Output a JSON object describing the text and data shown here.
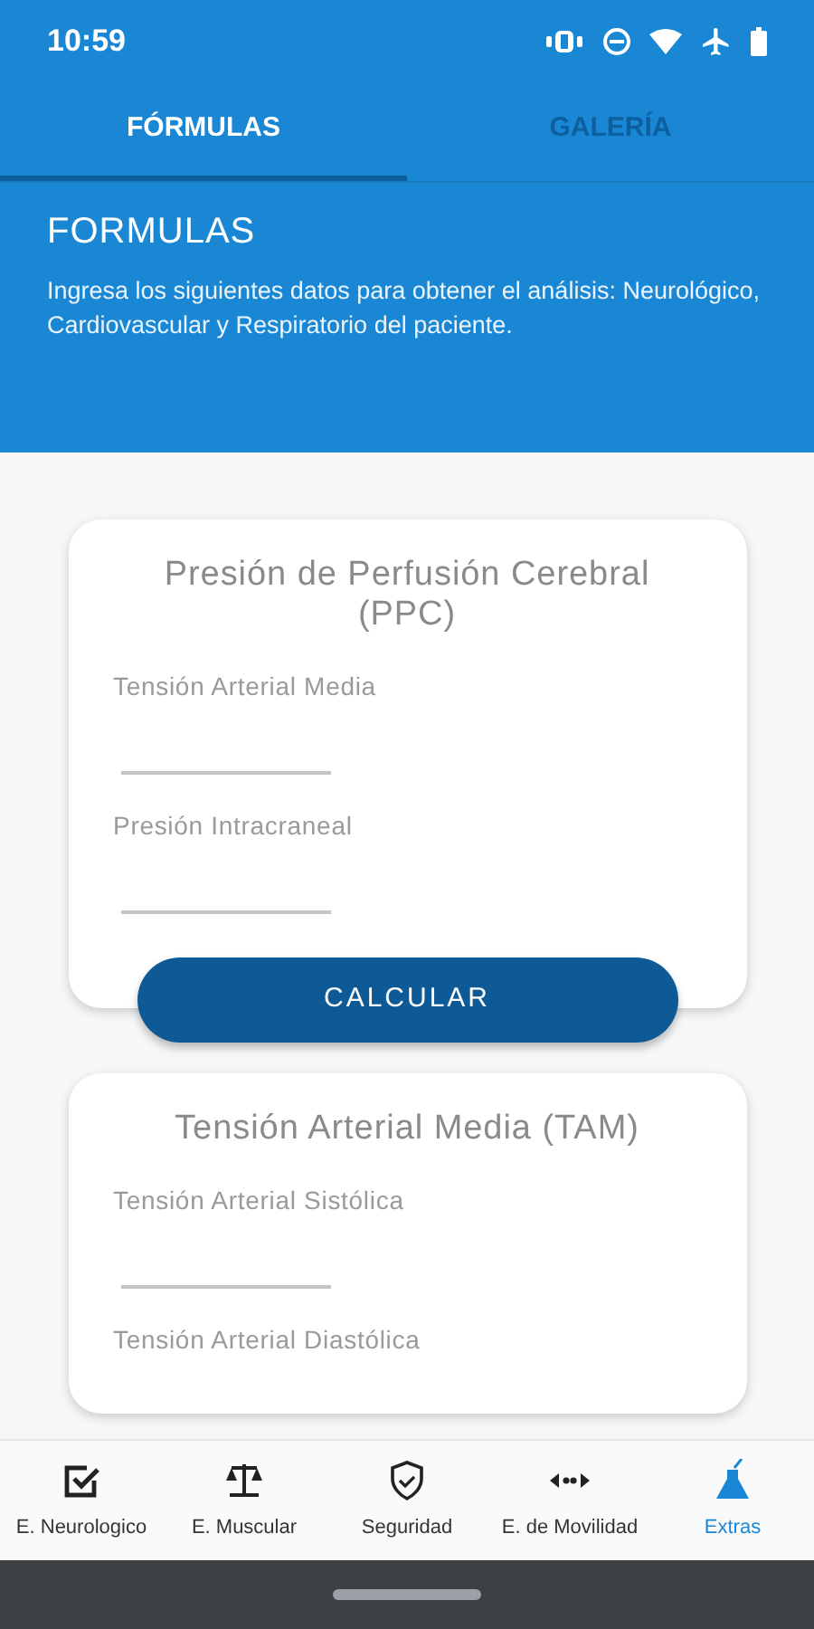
{
  "status_bar": {
    "time": "10:59"
  },
  "tabs": [
    {
      "label": "FÓRMULAS",
      "selected": true
    },
    {
      "label": "GALERÍA",
      "selected": false
    }
  ],
  "header": {
    "title": "FORMULAS",
    "description": "Ingresa los siguientes datos para obtener el análisis: Neurológico, Cardiovascular y Respiratorio del paciente."
  },
  "cards": [
    {
      "title": "Presión de Perfusión Cerebral (PPC)",
      "fields": [
        {
          "label": "Tensión Arterial Media"
        },
        {
          "label": "Presión Intracraneal"
        }
      ],
      "button": "CALCULAR"
    },
    {
      "title": "Tensión Arterial Media (TAM)",
      "fields": [
        {
          "label": "Tensión Arterial Sistólica"
        },
        {
          "label": "Tensión Arterial Diastólica"
        }
      ]
    }
  ],
  "bottom_nav": [
    {
      "label": "E. Neurologico",
      "kind": "check",
      "selected": false
    },
    {
      "label": "E. Muscular",
      "kind": "scale",
      "selected": false
    },
    {
      "label": "Seguridad",
      "kind": "shield",
      "selected": false
    },
    {
      "label": "E. de Movilidad",
      "kind": "arrows",
      "selected": false
    },
    {
      "label": "Extras",
      "kind": "flask",
      "selected": true
    }
  ]
}
